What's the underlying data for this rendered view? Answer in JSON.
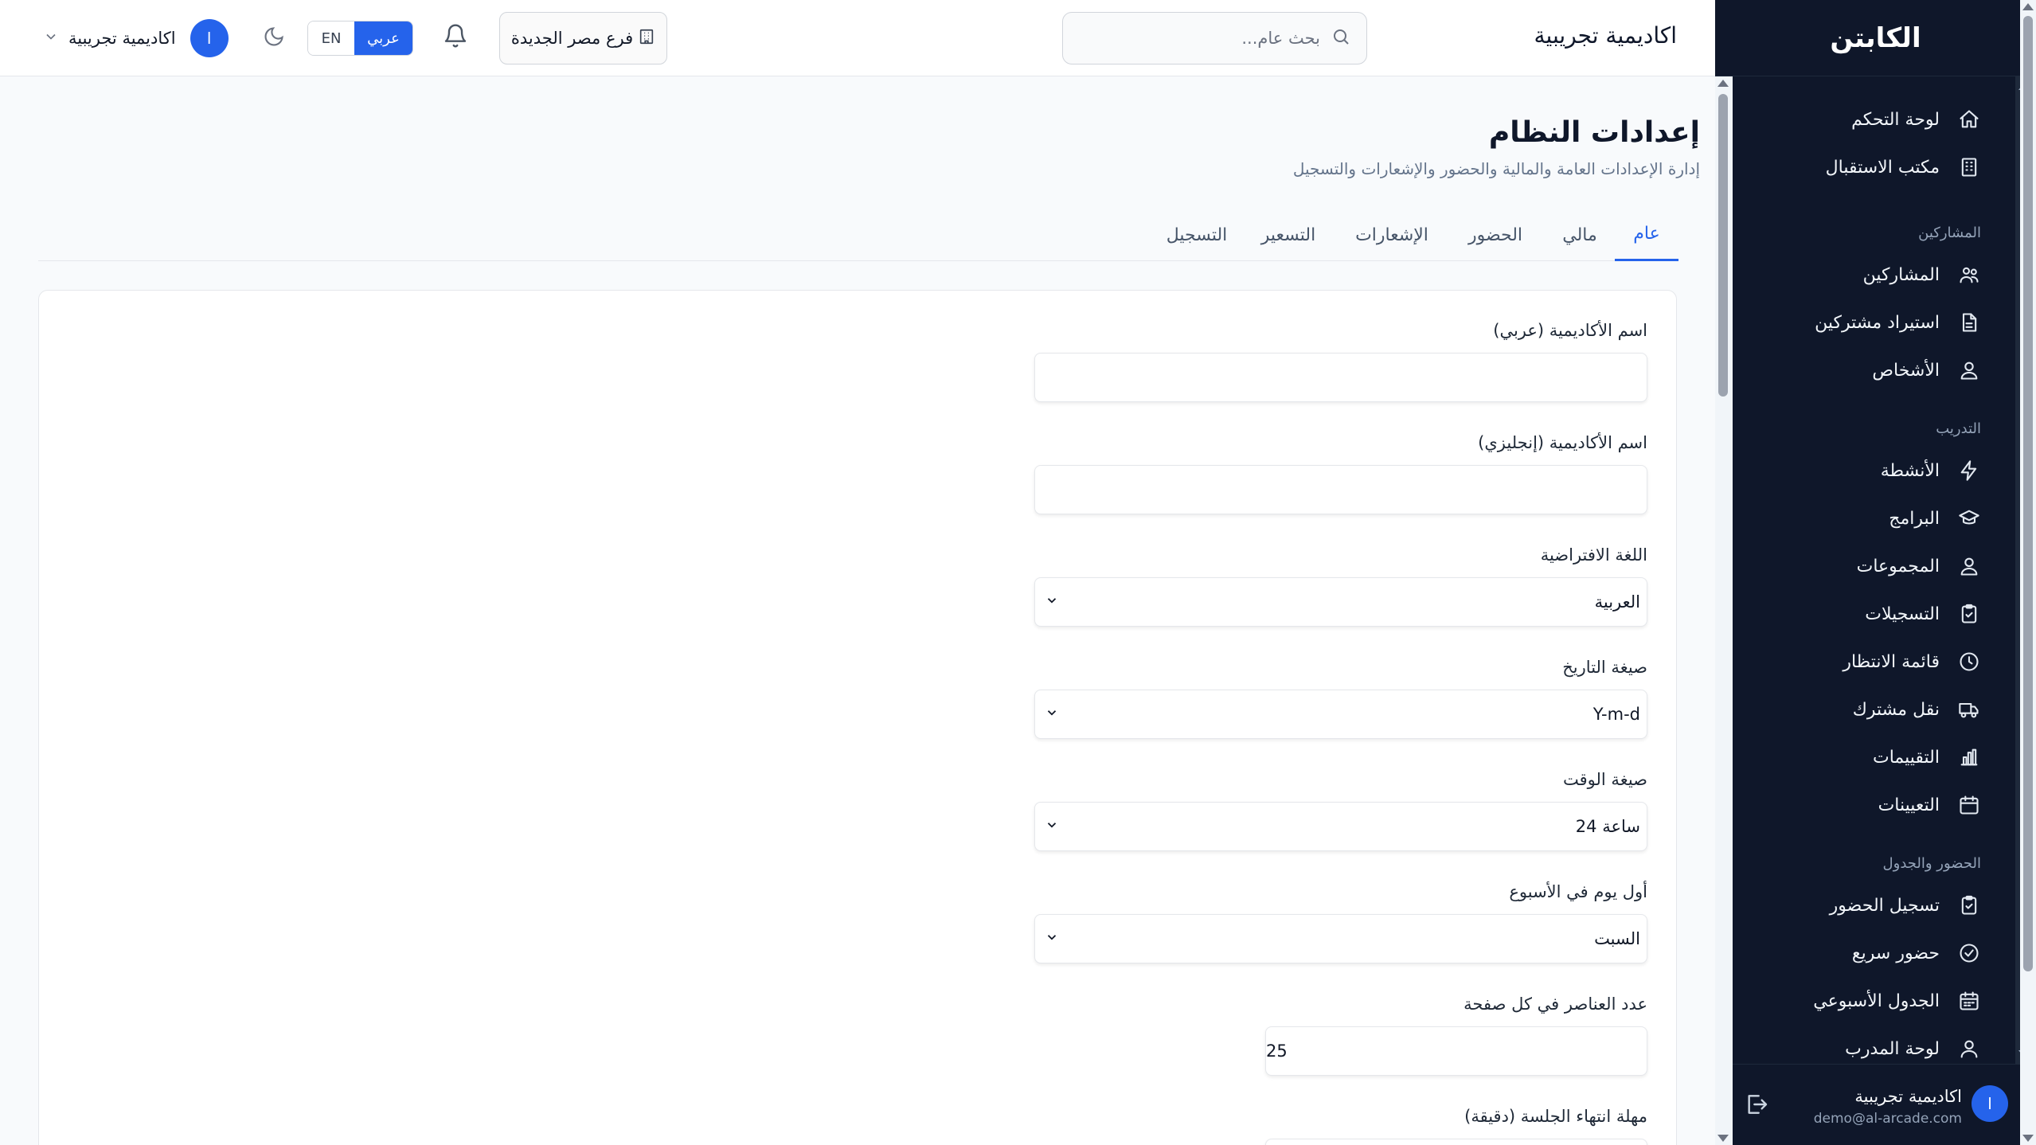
{
  "sidebar": {
    "brand": "الكابتن",
    "items": [
      {
        "label": "لوحة التحكم",
        "icon": "home-icon"
      },
      {
        "label": "مكتب الاستقبال",
        "icon": "building-icon"
      },
      {
        "section": "المشاركين"
      },
      {
        "label": "المشاركين",
        "icon": "users-icon"
      },
      {
        "label": "استيراد مشتركين",
        "icon": "file-icon"
      },
      {
        "label": "الأشخاص",
        "icon": "people-icon"
      },
      {
        "section": "التدريب"
      },
      {
        "label": "الأنشطة",
        "icon": "lightning-icon"
      },
      {
        "label": "البرامج",
        "icon": "graduation-cap-icon"
      },
      {
        "label": "المجموعات",
        "icon": "group-icon"
      },
      {
        "label": "التسجيلات",
        "icon": "clipboard-check-icon"
      },
      {
        "label": "قائمة الانتظار",
        "icon": "clock-icon"
      },
      {
        "label": "نقل مشترك",
        "icon": "truck-icon"
      },
      {
        "label": "التقييمات",
        "icon": "bar-chart-icon"
      },
      {
        "label": "التعيينات",
        "icon": "calendar-icon"
      },
      {
        "section": "الحضور والجدول"
      },
      {
        "label": "تسجيل الحضور",
        "icon": "clipboard-check-icon"
      },
      {
        "label": "حضور سريع",
        "icon": "check-circle-icon"
      },
      {
        "label": "الجدول الأسبوعي",
        "icon": "calendar-grid-icon"
      },
      {
        "label": "لوحة المدرب",
        "icon": "user-icon"
      }
    ],
    "footer": {
      "avatar_initial": "ا",
      "name": "اكاديمية تجريبية",
      "email": "demo@al-arcade.com"
    }
  },
  "header": {
    "academy_name": "اكاديمية تجريبية",
    "search_placeholder": "بحث عام...",
    "branch": "فرع مصر الجديدة",
    "lang_en": "EN",
    "lang_ar": "عربي",
    "user_name": "اكاديمية تجريبية",
    "user_initial": "ا"
  },
  "main": {
    "title": "إعدادات النظام",
    "subtitle": "إدارة الإعدادات العامة والمالية والحضور والإشعارات والتسجيل",
    "tabs": [
      "عام",
      "مالي",
      "الحضور",
      "الإشعارات",
      "التسعير",
      "التسجيل"
    ],
    "active_tab": "عام",
    "fields": {
      "name_ar_label": "اسم الأكاديمية (عربي)",
      "name_ar_value": "",
      "name_en_label": "اسم الأكاديمية (إنجليزي)",
      "name_en_value": "",
      "language_label": "اللغة الافتراضية",
      "language_value": "العربية",
      "date_format_label": "صيغة التاريخ",
      "date_format_value": "Y-m-d",
      "time_format_label": "صيغة الوقت",
      "time_format_value": "24 ساعة",
      "week_start_label": "أول يوم في الأسبوع",
      "week_start_value": "السبت",
      "per_page_label": "عدد العناصر في كل صفحة",
      "per_page_value": "25",
      "session_timeout_label": "مهلة انتهاء الجلسة (دقيقة)"
    }
  },
  "colors": {
    "sidebar_bg": "#0f172a",
    "accent": "#2563eb"
  }
}
